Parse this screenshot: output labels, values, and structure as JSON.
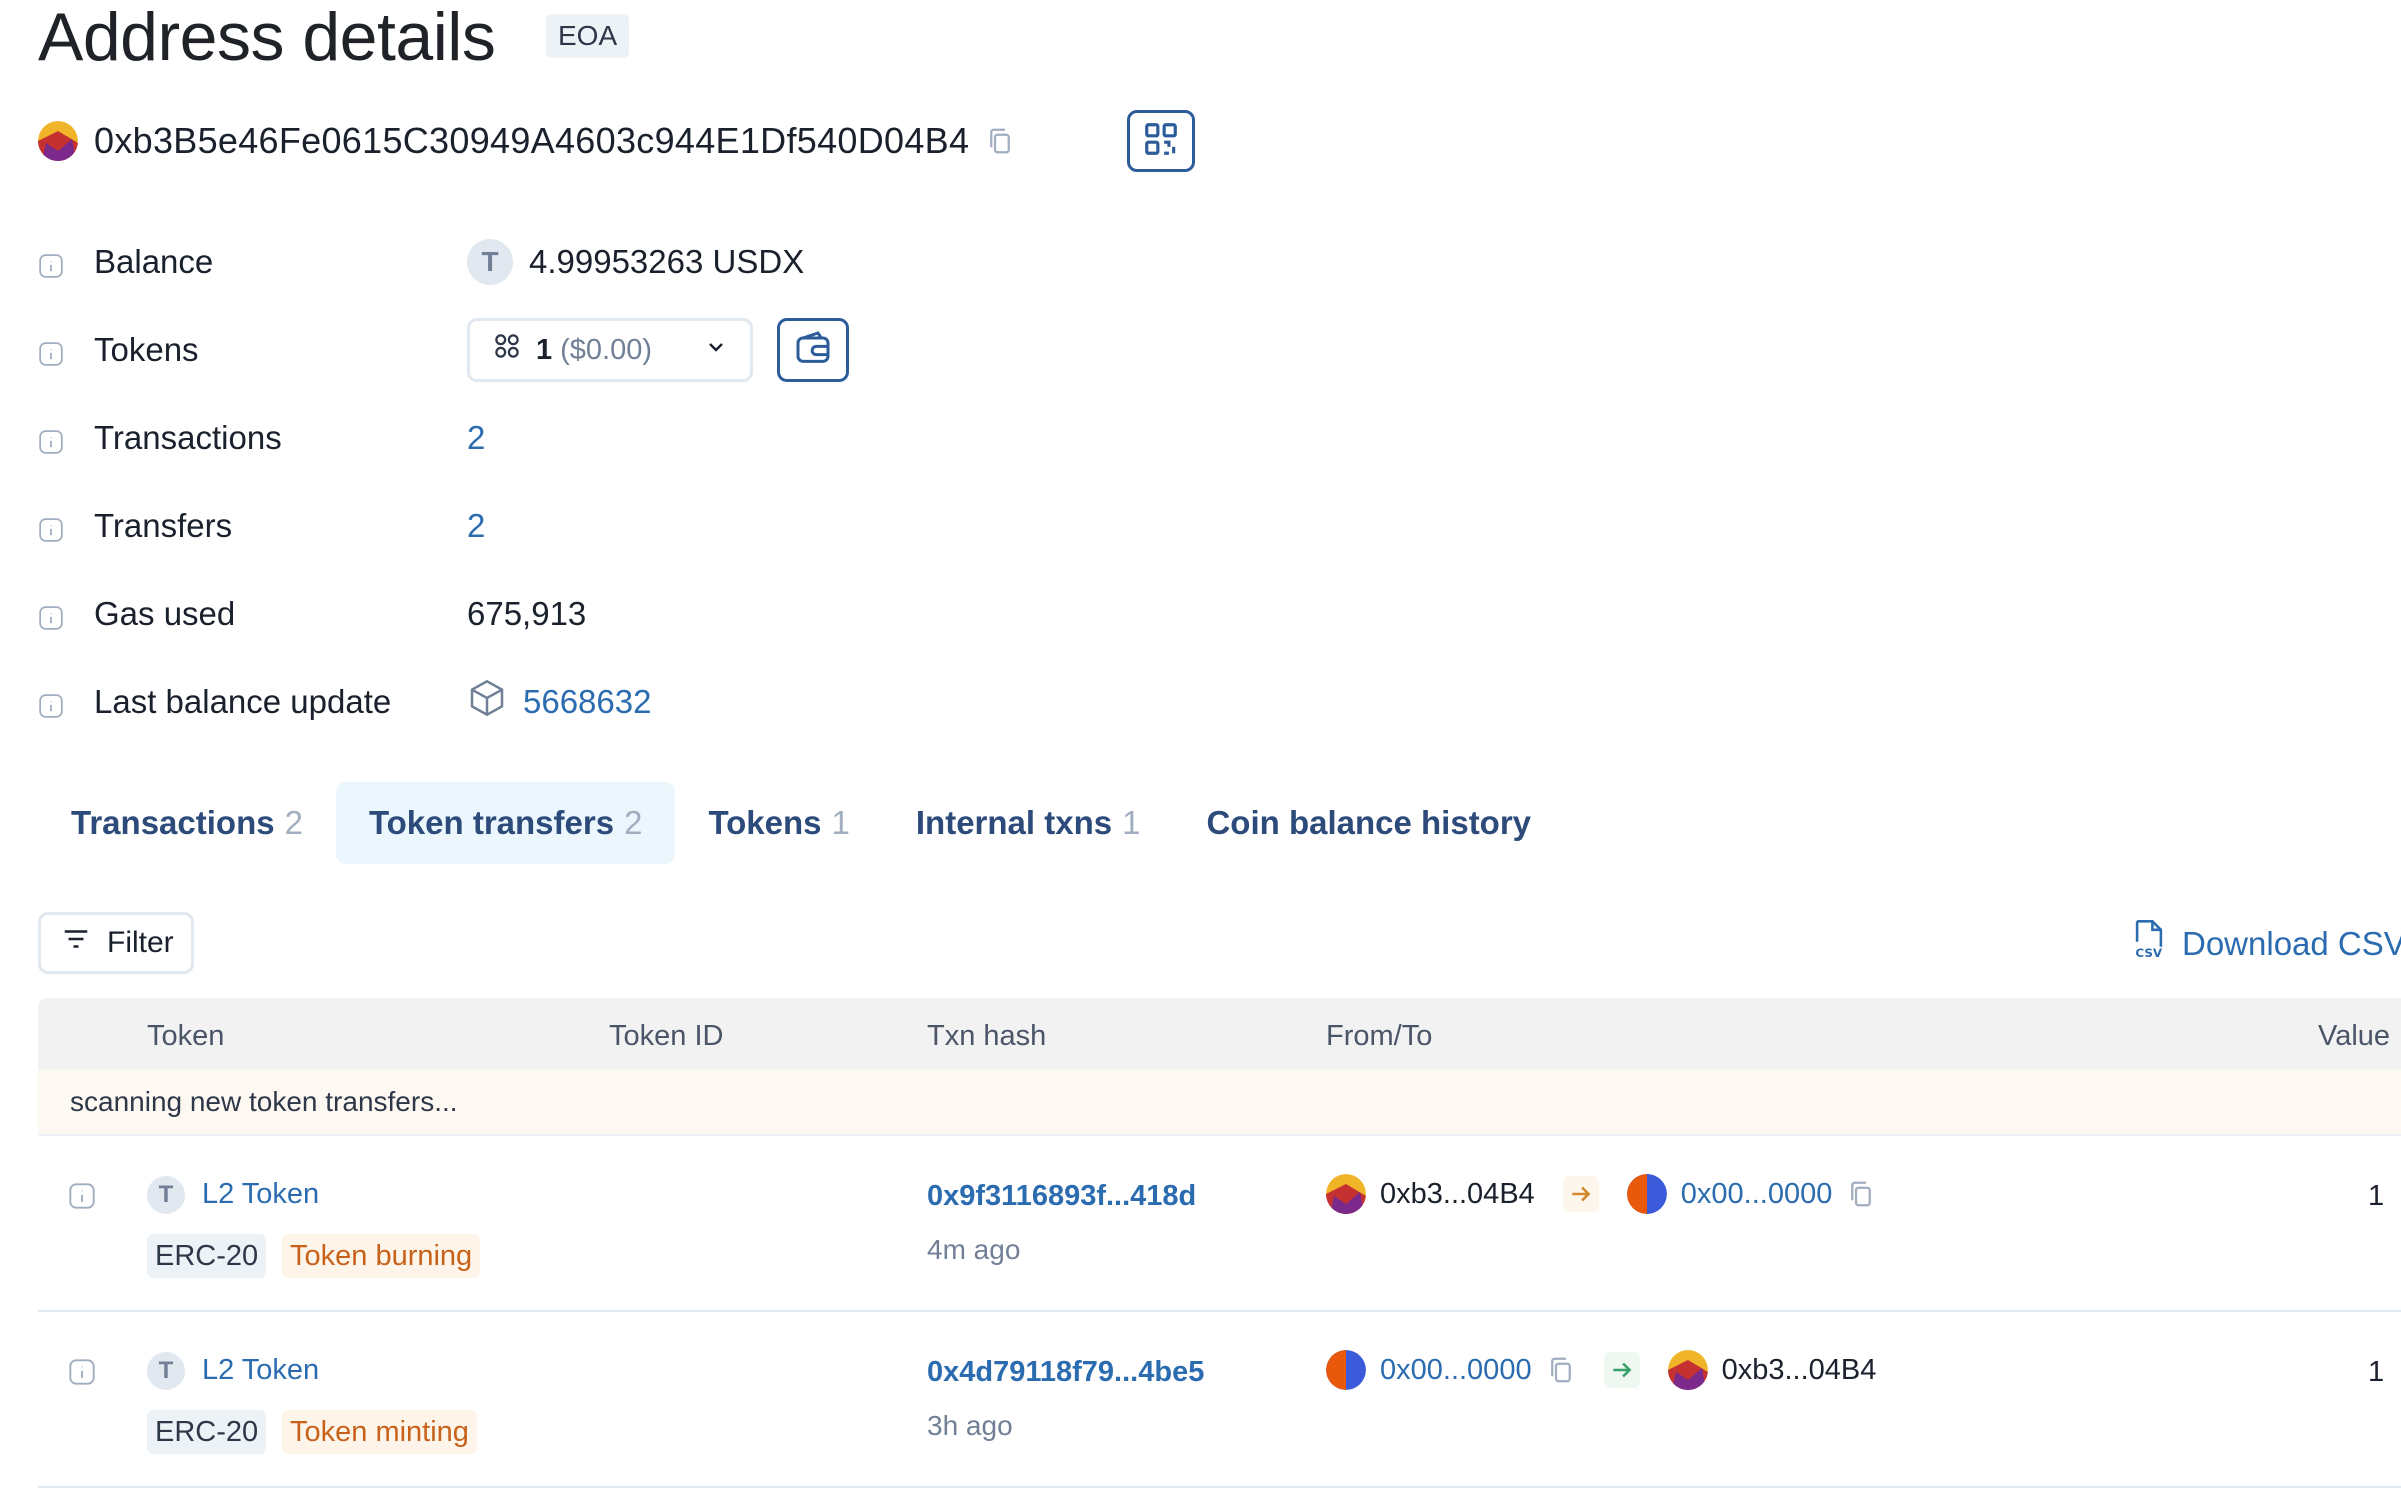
{
  "header": {
    "title": "Address details",
    "badge": "EOA",
    "address": "0xb3B5e46Fe0615C30949A4603c944E1Df540D04B4"
  },
  "details": {
    "balance_label": "Balance",
    "balance_value": "4.99953263 USDX",
    "balance_token_letter": "T",
    "tokens_label": "Tokens",
    "tokens_count": "1",
    "tokens_usd": "($0.00)",
    "transactions_label": "Transactions",
    "transactions_value": "2",
    "transfers_label": "Transfers",
    "transfers_value": "2",
    "gas_label": "Gas used",
    "gas_value": "675,913",
    "last_update_label": "Last balance update",
    "last_update_value": "5668632"
  },
  "tabs": [
    {
      "label": "Transactions",
      "count": "2"
    },
    {
      "label": "Token transfers",
      "count": "2"
    },
    {
      "label": "Tokens",
      "count": "1"
    },
    {
      "label": "Internal txns",
      "count": "1"
    },
    {
      "label": "Coin balance history",
      "count": ""
    }
  ],
  "toolbar": {
    "filter_label": "Filter",
    "download_label": "Download CSV"
  },
  "table": {
    "columns": [
      "Token",
      "Token ID",
      "Txn hash",
      "From/To",
      "Value"
    ],
    "scanning_text": "scanning new token transfers...",
    "rows": [
      {
        "token_letter": "T",
        "token_name": "L2 Token",
        "standard": "ERC-20",
        "type": "Token burning",
        "hash": "0x9f3116893f...418d",
        "age": "4m ago",
        "from": "0xb3...04B4",
        "to": "0x00...0000",
        "value": "1"
      },
      {
        "token_letter": "T",
        "token_name": "L2 Token",
        "standard": "ERC-20",
        "type": "Token minting",
        "hash": "0x4d79118f79...4be5",
        "age": "3h ago",
        "from": "0x00...0000",
        "to": "0xb3...04B4",
        "value": "1"
      }
    ]
  },
  "colors": {
    "link": "#2b6cb0",
    "accent_border": "#2c5c9a",
    "active_tab_bg": "#ebf6fd",
    "burn_tag": "#c8611a",
    "out_arrow": "#d08a2c",
    "in_arrow": "#38a169"
  },
  "icons": {
    "copy": "copy-icon",
    "qr": "qr-code-icon",
    "info": "info-icon",
    "wallet": "wallet-icon",
    "filter": "filter-icon",
    "csv": "csv-file-icon",
    "block": "block-cube-icon"
  }
}
